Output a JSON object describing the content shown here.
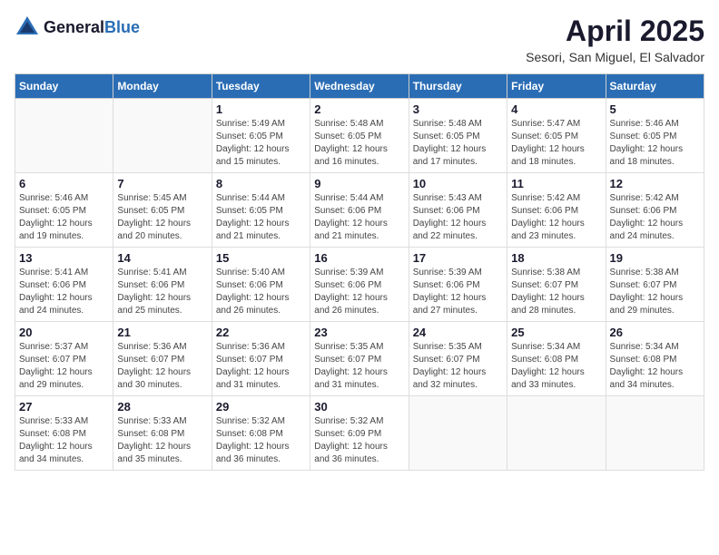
{
  "header": {
    "logo_general": "General",
    "logo_blue": "Blue",
    "month_year": "April 2025",
    "location": "Sesori, San Miguel, El Salvador"
  },
  "days_of_week": [
    "Sunday",
    "Monday",
    "Tuesday",
    "Wednesday",
    "Thursday",
    "Friday",
    "Saturday"
  ],
  "weeks": [
    [
      {
        "day": "",
        "content": ""
      },
      {
        "day": "",
        "content": ""
      },
      {
        "day": "1",
        "content": "Sunrise: 5:49 AM\nSunset: 6:05 PM\nDaylight: 12 hours\nand 15 minutes."
      },
      {
        "day": "2",
        "content": "Sunrise: 5:48 AM\nSunset: 6:05 PM\nDaylight: 12 hours\nand 16 minutes."
      },
      {
        "day": "3",
        "content": "Sunrise: 5:48 AM\nSunset: 6:05 PM\nDaylight: 12 hours\nand 17 minutes."
      },
      {
        "day": "4",
        "content": "Sunrise: 5:47 AM\nSunset: 6:05 PM\nDaylight: 12 hours\nand 18 minutes."
      },
      {
        "day": "5",
        "content": "Sunrise: 5:46 AM\nSunset: 6:05 PM\nDaylight: 12 hours\nand 18 minutes."
      }
    ],
    [
      {
        "day": "6",
        "content": "Sunrise: 5:46 AM\nSunset: 6:05 PM\nDaylight: 12 hours\nand 19 minutes."
      },
      {
        "day": "7",
        "content": "Sunrise: 5:45 AM\nSunset: 6:05 PM\nDaylight: 12 hours\nand 20 minutes."
      },
      {
        "day": "8",
        "content": "Sunrise: 5:44 AM\nSunset: 6:05 PM\nDaylight: 12 hours\nand 21 minutes."
      },
      {
        "day": "9",
        "content": "Sunrise: 5:44 AM\nSunset: 6:06 PM\nDaylight: 12 hours\nand 21 minutes."
      },
      {
        "day": "10",
        "content": "Sunrise: 5:43 AM\nSunset: 6:06 PM\nDaylight: 12 hours\nand 22 minutes."
      },
      {
        "day": "11",
        "content": "Sunrise: 5:42 AM\nSunset: 6:06 PM\nDaylight: 12 hours\nand 23 minutes."
      },
      {
        "day": "12",
        "content": "Sunrise: 5:42 AM\nSunset: 6:06 PM\nDaylight: 12 hours\nand 24 minutes."
      }
    ],
    [
      {
        "day": "13",
        "content": "Sunrise: 5:41 AM\nSunset: 6:06 PM\nDaylight: 12 hours\nand 24 minutes."
      },
      {
        "day": "14",
        "content": "Sunrise: 5:41 AM\nSunset: 6:06 PM\nDaylight: 12 hours\nand 25 minutes."
      },
      {
        "day": "15",
        "content": "Sunrise: 5:40 AM\nSunset: 6:06 PM\nDaylight: 12 hours\nand 26 minutes."
      },
      {
        "day": "16",
        "content": "Sunrise: 5:39 AM\nSunset: 6:06 PM\nDaylight: 12 hours\nand 26 minutes."
      },
      {
        "day": "17",
        "content": "Sunrise: 5:39 AM\nSunset: 6:06 PM\nDaylight: 12 hours\nand 27 minutes."
      },
      {
        "day": "18",
        "content": "Sunrise: 5:38 AM\nSunset: 6:07 PM\nDaylight: 12 hours\nand 28 minutes."
      },
      {
        "day": "19",
        "content": "Sunrise: 5:38 AM\nSunset: 6:07 PM\nDaylight: 12 hours\nand 29 minutes."
      }
    ],
    [
      {
        "day": "20",
        "content": "Sunrise: 5:37 AM\nSunset: 6:07 PM\nDaylight: 12 hours\nand 29 minutes."
      },
      {
        "day": "21",
        "content": "Sunrise: 5:36 AM\nSunset: 6:07 PM\nDaylight: 12 hours\nand 30 minutes."
      },
      {
        "day": "22",
        "content": "Sunrise: 5:36 AM\nSunset: 6:07 PM\nDaylight: 12 hours\nand 31 minutes."
      },
      {
        "day": "23",
        "content": "Sunrise: 5:35 AM\nSunset: 6:07 PM\nDaylight: 12 hours\nand 31 minutes."
      },
      {
        "day": "24",
        "content": "Sunrise: 5:35 AM\nSunset: 6:07 PM\nDaylight: 12 hours\nand 32 minutes."
      },
      {
        "day": "25",
        "content": "Sunrise: 5:34 AM\nSunset: 6:08 PM\nDaylight: 12 hours\nand 33 minutes."
      },
      {
        "day": "26",
        "content": "Sunrise: 5:34 AM\nSunset: 6:08 PM\nDaylight: 12 hours\nand 34 minutes."
      }
    ],
    [
      {
        "day": "27",
        "content": "Sunrise: 5:33 AM\nSunset: 6:08 PM\nDaylight: 12 hours\nand 34 minutes."
      },
      {
        "day": "28",
        "content": "Sunrise: 5:33 AM\nSunset: 6:08 PM\nDaylight: 12 hours\nand 35 minutes."
      },
      {
        "day": "29",
        "content": "Sunrise: 5:32 AM\nSunset: 6:08 PM\nDaylight: 12 hours\nand 36 minutes."
      },
      {
        "day": "30",
        "content": "Sunrise: 5:32 AM\nSunset: 6:09 PM\nDaylight: 12 hours\nand 36 minutes."
      },
      {
        "day": "",
        "content": ""
      },
      {
        "day": "",
        "content": ""
      },
      {
        "day": "",
        "content": ""
      }
    ]
  ]
}
